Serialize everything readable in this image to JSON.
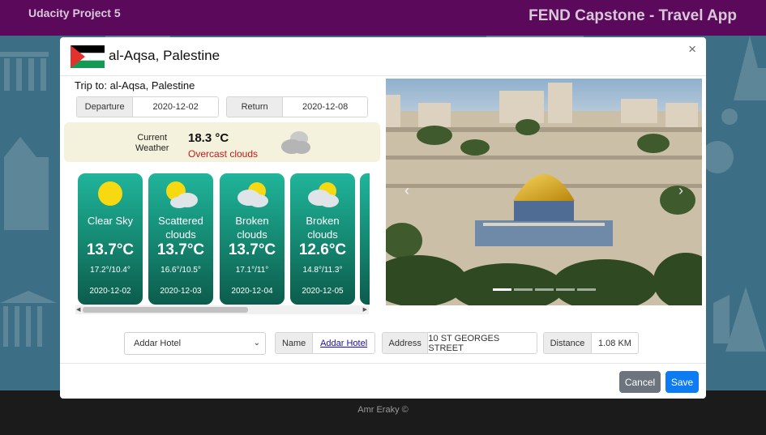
{
  "navbar": {
    "brand": "Udacity Project 5",
    "title": "FEND Capstone - Travel App"
  },
  "modal": {
    "title": "al-Aqsa, Palestine",
    "close": "×",
    "trip_to": "Trip to: al-Aqsa, Palestine",
    "departure": {
      "label": "Departure",
      "value": "2020-12-02"
    },
    "return": {
      "label": "Return",
      "value": "2020-12-08"
    },
    "current_weather": {
      "label_line1": "Current",
      "label_line2": "Weather",
      "temp": "18.3 °C",
      "description": "Overcast clouds",
      "icon": "cloud-icon"
    },
    "forecast": [
      {
        "desc_line1": "Clear Sky",
        "desc_line2": "",
        "temp": "13.7°C",
        "range": "17.2°/10.4°",
        "date": "2020-12-02",
        "icon": "sun-icon"
      },
      {
        "desc_line1": "Scattered",
        "desc_line2": "clouds",
        "temp": "13.7°C",
        "range": "16.6°/10.5°",
        "date": "2020-12-03",
        "icon": "sun-cloud-icon"
      },
      {
        "desc_line1": "Broken",
        "desc_line2": "clouds",
        "temp": "13.7°C",
        "range": "17.1°/11°",
        "date": "2020-12-04",
        "icon": "cloud-sun-icon"
      },
      {
        "desc_line1": "Broken",
        "desc_line2": "clouds",
        "temp": "12.6°C",
        "range": "14.8°/11.3°",
        "date": "2020-12-05",
        "icon": "cloud-sun-icon"
      }
    ],
    "carousel": {
      "prev": "‹",
      "next": "›",
      "slides": 5,
      "active_slide": 1
    },
    "hotel": {
      "selected": "Addar Hotel",
      "name_label": "Name",
      "name_value": "Addar Hotel",
      "address_label": "Address",
      "address_value": "10 ST GEORGES STREET",
      "distance_label": "Distance",
      "distance_value": "1.08 KM"
    },
    "buttons": {
      "cancel": "Cancel",
      "save": "Save"
    }
  },
  "footer": {
    "text": "Amr Eraky ©"
  },
  "colors": {
    "navbar": "#5b0a5b",
    "card": "#14856f",
    "save": "#0d7bf2",
    "cancel": "#6c757d",
    "weather_desc": "#c41a1a"
  }
}
